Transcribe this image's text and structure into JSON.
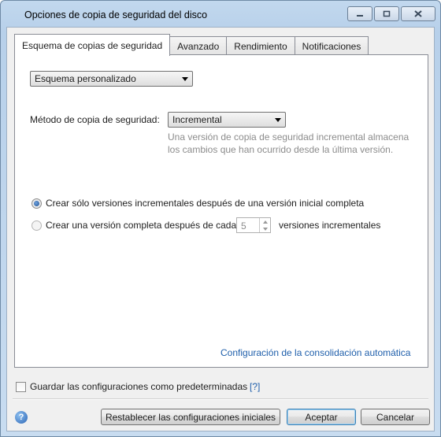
{
  "window": {
    "title": "Opciones de copia de seguridad del disco",
    "controls": {
      "minimize_icon": "minimize-icon",
      "maximize_icon": "maximize-icon",
      "close_icon": "close-icon"
    }
  },
  "tabs": [
    {
      "label": "Esquema de copias de seguridad",
      "active": true
    },
    {
      "label": "Avanzado",
      "active": false
    },
    {
      "label": "Rendimiento",
      "active": false
    },
    {
      "label": "Notificaciones",
      "active": false
    }
  ],
  "scheme": {
    "selected": "Esquema personalizado"
  },
  "method": {
    "label": "Método de copia de seguridad:",
    "selected": "Incremental",
    "hint_line1": "Una versión de copia de seguridad incremental almacena",
    "hint_line2": "los cambios que han ocurrido desde la última versión."
  },
  "options": {
    "radio1_label": "Crear sólo versiones incrementales después de una versión inicial completa",
    "radio1_checked": true,
    "radio2_label": "Crear una versión completa después de cada",
    "radio2_checked": false,
    "spin_value": "5",
    "radio2_suffix": "versiones incrementales"
  },
  "consolidation_link": "Configuración de la consolidación automática",
  "save_default": {
    "label": "Guardar las configuraciones como predeterminadas",
    "help": "[?]",
    "checked": false
  },
  "footer": {
    "reset_label": "Restablecer las configuraciones iniciales",
    "ok_label": "Aceptar",
    "cancel_label": "Cancelar",
    "help_icon": "question-icon"
  },
  "colors": {
    "link": "#1f5fab",
    "accent": "#3c7fb1",
    "hint": "#8c8c8c"
  }
}
